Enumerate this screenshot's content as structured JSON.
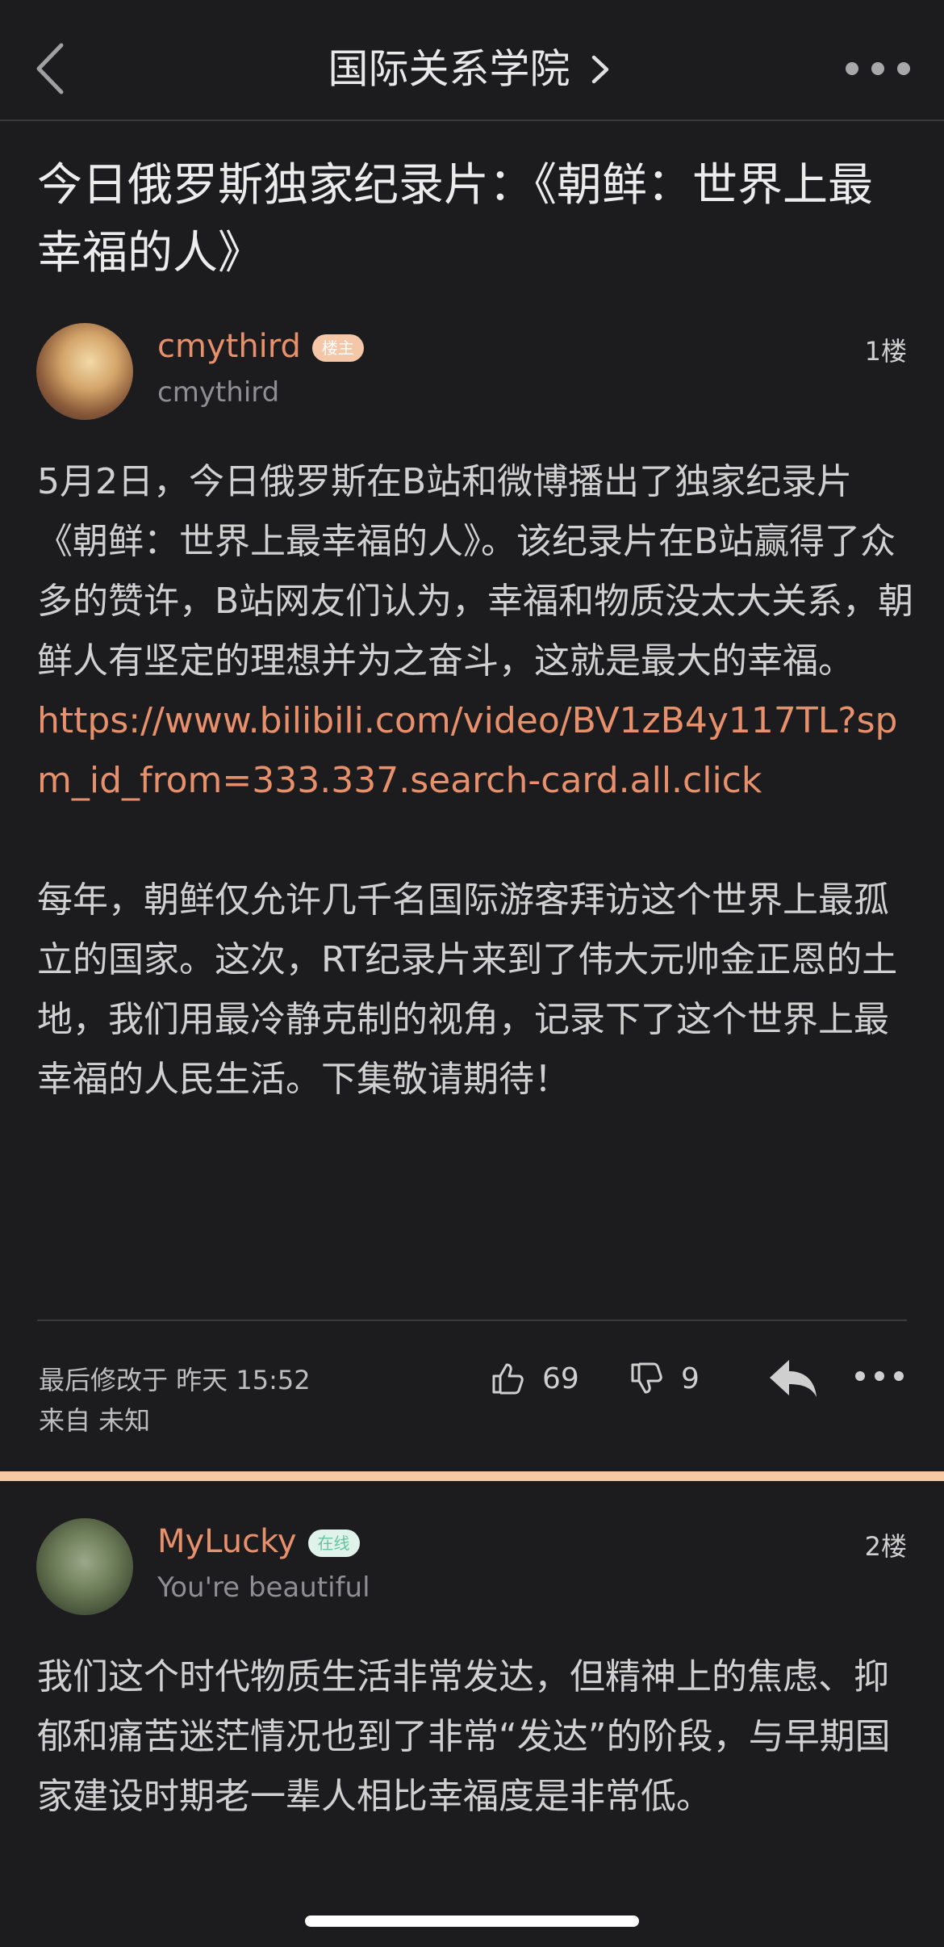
{
  "nav": {
    "title": "国际关系学院",
    "back_icon": "chevron-left-icon",
    "title_arrow_icon": "chevron-right-icon",
    "more_icon": "more-horizontal-icon"
  },
  "post": {
    "title": "今日俄罗斯独家纪录片：《朝鲜：世界上最幸福的人》",
    "author": {
      "name": "cmythird",
      "badge": "楼主",
      "subtitle": "cmythird"
    },
    "floor": "1楼",
    "body_p1": "5月2日，今日俄罗斯在B站和微博播出了独家纪录片《朝鲜：世界上最幸福的人》。该纪录片在B站赢得了众多的赞许，B站网友们认为，幸福和物质没太大关系，朝鲜人有坚定的理想并为之奋斗，这就是最大的幸福。",
    "link": "https://www.bilibili.com/video/BV1zB4y117TL?spm_id_from=333.337.search-card.all.click",
    "body_p2": "每年，朝鲜仅允许几千名国际游客拜访这个世界上最孤立的国家。这次，RT纪录片来到了伟大元帅金正恩的土地，我们用最冷静克制的视角，记录下了这个世界上最幸福的人民生活。下集敬请期待！",
    "modified": "最后修改于 昨天 15:52",
    "source": "来自 未知",
    "likes": "69",
    "dislikes": "9"
  },
  "reply": {
    "author": {
      "name": "MyLucky",
      "badge": "在线",
      "subtitle": "You're beautiful"
    },
    "floor": "2楼",
    "body": "我们这个时代物质生活非常发达，但精神上的焦虑、抑郁和痛苦迷茫情况也到了非常“发达”的阶段，与早期国家建设时期老一辈人相比幸福度是非常低。"
  },
  "colors": {
    "background": "#1c1c1e",
    "accent": "#e8906c",
    "separator": "#f6c9a3"
  }
}
